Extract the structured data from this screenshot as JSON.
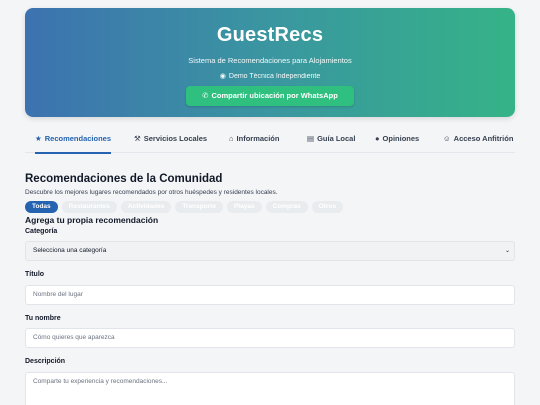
{
  "header": {
    "title": "GuestRecs",
    "subtitle": "Sistema de Recomendaciones para Alojamientos",
    "location": "Demo Técnica Independiente",
    "whatsapp_button": "Compartir ubicación por WhatsApp"
  },
  "tabs": [
    {
      "label": "Recomendaciones",
      "icon": "star-icon",
      "active": true
    },
    {
      "label": "Servicios Locales",
      "icon": "tools-icon",
      "active": false
    },
    {
      "label": "Información",
      "icon": "home-icon",
      "active": false
    },
    {
      "label": "Guía Local",
      "icon": "book-icon",
      "active": false
    },
    {
      "label": "Opiniones",
      "icon": "comment-icon",
      "active": false
    },
    {
      "label": "Acceso Anfitrión",
      "icon": "user-icon",
      "active": false
    }
  ],
  "main": {
    "section_title": "Recomendaciones de la Comunidad",
    "section_desc": "Descubre los mejores lugares recomendados por otros huéspedes y residentes locales.",
    "filters": [
      "Todas",
      "Restaurantes",
      "Actividades",
      "Transporte",
      "Playas",
      "Compras",
      "Otros"
    ],
    "active_filter": "Todas"
  },
  "form": {
    "title": "Agrega tu propia recomendación",
    "category_label": "Categoría",
    "category_value": "Selecciona una categoría",
    "title_label": "Título",
    "title_placeholder": "Nombre del lugar",
    "name_label": "Tu nombre",
    "name_placeholder": "Cómo quieres que aparezca",
    "description_label": "Descripción",
    "description_placeholder": "Comparte tu experiencia y recomendaciones..."
  },
  "colors": {
    "accent": "#2563b0",
    "whatsapp": "#2fbf7e",
    "gradient_start": "#3d72b0",
    "gradient_end": "#35b387"
  }
}
